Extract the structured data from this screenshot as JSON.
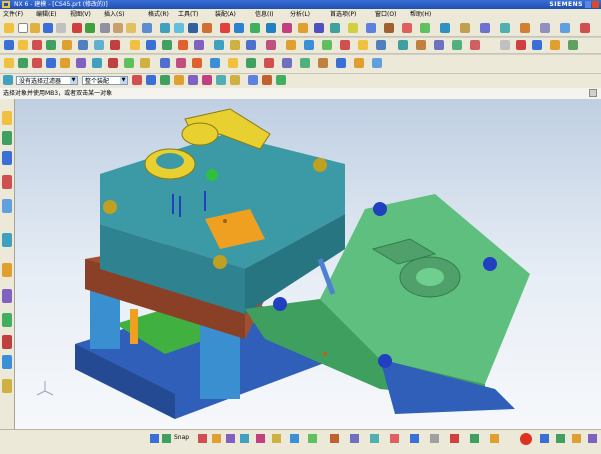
{
  "window": {
    "title": "NX 6 - 建模 - [CS45.prt (修改的)]",
    "brand": "SIEMENS"
  },
  "menu": [
    "文件(F)",
    "编辑(E)",
    "视图(V)",
    "插入(S)",
    "格式(R)",
    "工具(T)",
    "装配(A)",
    "信息(I)",
    "分析(L)",
    "首选项(P)",
    "窗口(O)",
    "帮助(H)"
  ],
  "selection": {
    "filter": "没有选择过滤器",
    "scope": "整个装配"
  },
  "cue": {
    "prompt": "选择对象并使用MB3，或者双击某一对象"
  },
  "status": {
    "label": "Snap"
  },
  "colors": {
    "teal": "#3b9aa6",
    "green": "#5fbf7f",
    "brown": "#a05030",
    "blue": "#2f5fb8",
    "yellow": "#e8d030",
    "orange": "#f0a020"
  }
}
